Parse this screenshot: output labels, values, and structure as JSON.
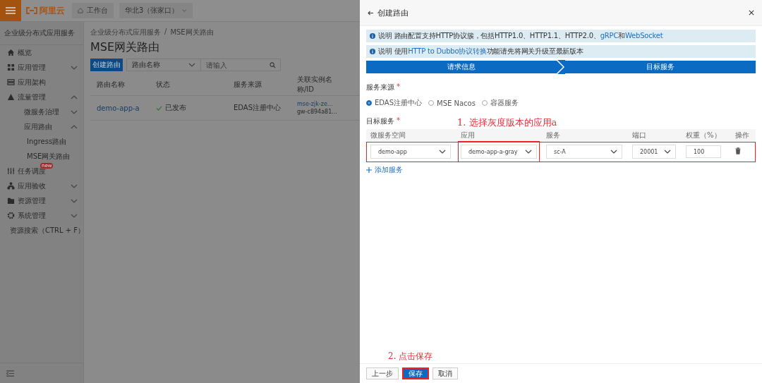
{
  "topbar": {
    "logo": "阿里云",
    "workbench": "工作台",
    "region": "华北3（张家口）"
  },
  "sidebar": {
    "title": "企业级分布式应用服务",
    "items": [
      {
        "label": "概览"
      },
      {
        "label": "应用管理",
        "expanded": false
      },
      {
        "label": "应用架构"
      },
      {
        "label": "流量管理",
        "expanded": true,
        "children": [
          {
            "label": "微服务治理",
            "expanded": false
          },
          {
            "label": "应用路由",
            "expanded": true,
            "children": [
              {
                "label": "Ingress路由"
              },
              {
                "label": "MSE网关路由"
              }
            ]
          }
        ]
      },
      {
        "label": "任务调度",
        "badge": "new"
      },
      {
        "label": "应用验收",
        "expanded": false
      },
      {
        "label": "资源管理",
        "expanded": false
      },
      {
        "label": "系统管理",
        "expanded": false
      },
      {
        "label": "资源搜索（CTRL + F）"
      }
    ]
  },
  "main": {
    "breadcrumb": [
      "企业级分布式应用服务",
      "MSE网关路由"
    ],
    "breadcrumb_separator": "/",
    "title": "MSE网关路由",
    "create_button": "创建路由",
    "filter": "路由名称",
    "search": {
      "placeholder": "请输入"
    },
    "table": {
      "columns": [
        "路由名称",
        "状态",
        "服务来源",
        "关联实例名称/ID"
      ],
      "rows": [
        {
          "name": "demo-app-a",
          "status": "已发布",
          "source": "EDAS注册中心",
          "instance": [
            "mse-zjk-ze...",
            "gw-c894a81..."
          ]
        }
      ]
    }
  },
  "drawer": {
    "title": "创建路由",
    "notices": [
      [
        {
          "text": "说明 路由配置支持HTTP协议簇，包括HTTP1.0、HTTP1.1、HTTP2.0、"
        },
        {
          "text": "gRPC",
          "link": true
        },
        {
          "text": "和"
        },
        {
          "text": "WebSocket",
          "link": true
        }
      ],
      [
        {
          "text": "说明 使用"
        },
        {
          "text": "HTTP to Dubbo协议转换",
          "link": true
        },
        {
          "text": "功能请先将网关升级至最新版本"
        }
      ]
    ],
    "steps": [
      "请求信息",
      "目标服务"
    ],
    "source": {
      "label": "服务来源",
      "required_mark": "*",
      "options": [
        {
          "label": "EDAS注册中心",
          "selected": true
        },
        {
          "label": "MSE Nacos",
          "selected": false
        },
        {
          "label": "容器服务",
          "selected": false
        }
      ]
    },
    "target": {
      "label": "目标服务",
      "required_mark": "*",
      "columns": [
        "微服务空间",
        "应用",
        "服务",
        "端口",
        "权重（%）",
        "操作"
      ],
      "rows": [
        {
          "namespace": "demo-app",
          "app": "demo-app-a-gray",
          "service": "sc-A",
          "port": "20001",
          "weight": "100",
          "highlighted": true,
          "app_highlighted": true
        }
      ],
      "add": "添加服务"
    },
    "buttons": [
      {
        "label": "上一步",
        "kind": "default",
        "highlighted": false
      },
      {
        "label": "保存",
        "kind": "primary",
        "highlighted": true
      },
      {
        "label": "取消",
        "kind": "default",
        "highlighted": false
      }
    ]
  },
  "annotations": [
    {
      "text": "1. 选择灰度版本的应用a"
    },
    {
      "text": "2. 点击保存"
    }
  ]
}
